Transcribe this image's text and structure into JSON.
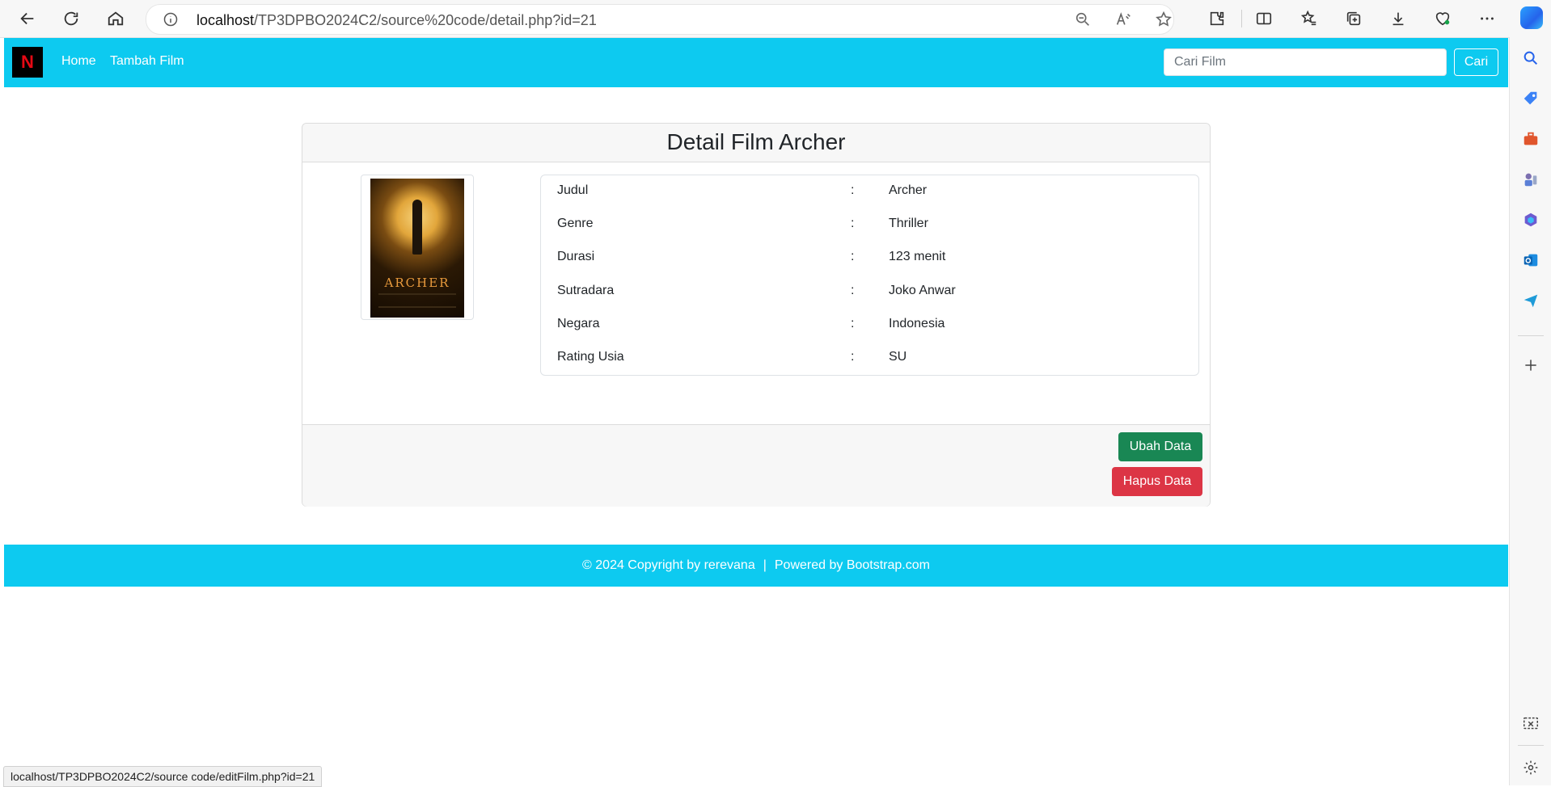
{
  "browser": {
    "url_host": "localhost",
    "url_path": "/TP3DPBO2024C2/source%20code/detail.php?id=21",
    "status_url": "localhost/TP3DPBO2024C2/source code/editFilm.php?id=21"
  },
  "navbar": {
    "brand_letter": "N",
    "links": [
      "Home",
      "Tambah Film"
    ],
    "search_placeholder": "Cari Film",
    "search_button": "Cari"
  },
  "card": {
    "title": "Detail Film Archer",
    "poster": {
      "title_text": "ARCHER"
    },
    "rows": [
      {
        "label": "Judul",
        "sep": ":",
        "value": "Archer"
      },
      {
        "label": "Genre",
        "sep": ":",
        "value": "Thriller"
      },
      {
        "label": "Durasi",
        "sep": ":",
        "value": "123 menit"
      },
      {
        "label": "Sutradara",
        "sep": ":",
        "value": "Joko Anwar"
      },
      {
        "label": "Negara",
        "sep": ":",
        "value": "Indonesia"
      },
      {
        "label": "Rating Usia",
        "sep": ":",
        "value": "SU"
      }
    ],
    "edit_button": "Ubah Data",
    "delete_button": "Hapus Data"
  },
  "footer": {
    "copyright": "© 2024 Copyright by rerevana",
    "separator": "|",
    "powered": "Powered by Bootstrap.com"
  },
  "colors": {
    "navbar": "#0dcaf0",
    "edit_button": "#198754",
    "delete_button": "#dc3545"
  }
}
